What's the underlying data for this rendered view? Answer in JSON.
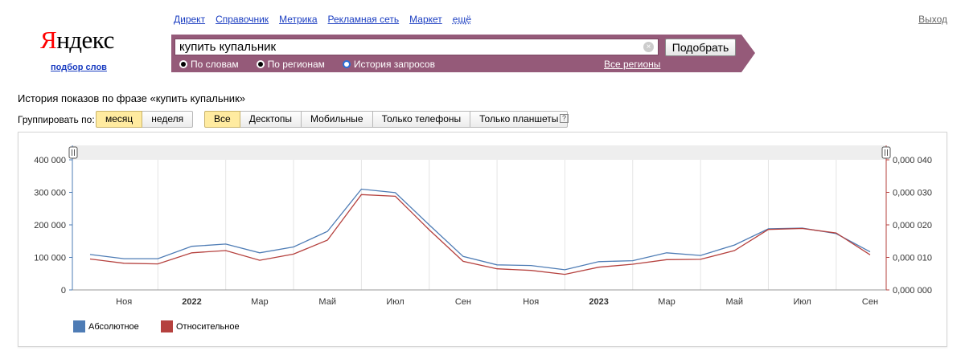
{
  "header": {
    "logo_first": "Я",
    "logo_rest": "ндекс",
    "logo_sub": "подбор слов",
    "services": [
      "Директ",
      "Справочник",
      "Метрика",
      "Рекламная сеть",
      "Маркет"
    ],
    "more": "ещё",
    "logout": "Выход"
  },
  "search": {
    "query": "купить купальник",
    "clear_icon": "×",
    "submit": "Подобрать",
    "modes": [
      {
        "label": "По словам",
        "selected": false
      },
      {
        "label": "По регионам",
        "selected": false
      },
      {
        "label": "История запросов",
        "selected": true
      }
    ],
    "regions": "Все регионы"
  },
  "page": {
    "title": "История показов по фразе «купить купальник»",
    "group_label": "Группировать по:",
    "group_options": [
      {
        "label": "месяц",
        "active": true
      },
      {
        "label": "неделя",
        "active": false
      }
    ],
    "device_options": [
      {
        "label": "Все",
        "active": true
      },
      {
        "label": "Десктопы",
        "active": false
      },
      {
        "label": "Мобильные",
        "active": false
      },
      {
        "label": "Только телефоны",
        "active": false
      },
      {
        "label": "Только планшеты",
        "active": false
      }
    ],
    "help_icon": "?"
  },
  "colors": {
    "absolute": "#4e7cb5",
    "relative": "#b5413e",
    "accent_panel": "#955a79"
  },
  "chart_data": {
    "type": "line",
    "x_labels": [
      "Ноя",
      "2022",
      "Мар",
      "Май",
      "Июл",
      "Сен",
      "Ноя",
      "2023",
      "Мар",
      "Май",
      "Июл",
      "Сен"
    ],
    "x_labels_bold": [
      "2022",
      "2023"
    ],
    "left_axis": {
      "ticks": [
        "0",
        "100 000",
        "200 000",
        "300 000",
        "400 000"
      ],
      "ylim": [
        0,
        400000
      ]
    },
    "right_axis": {
      "ticks": [
        "0,000 000",
        "0,000 010",
        "0,000 020",
        "0,000 030",
        "0,000 040"
      ],
      "ylim": [
        0,
        4e-05
      ]
    },
    "months": [
      "2021-10",
      "2021-11",
      "2021-12",
      "2022-01",
      "2022-02",
      "2022-03",
      "2022-04",
      "2022-05",
      "2022-06",
      "2022-07",
      "2022-08",
      "2022-09",
      "2022-10",
      "2022-11",
      "2022-12",
      "2023-01",
      "2023-02",
      "2023-03",
      "2023-04",
      "2023-05",
      "2023-06",
      "2023-07",
      "2023-08",
      "2023-09"
    ],
    "series": [
      {
        "name": "Абсолютное",
        "color": "#4e7cb5",
        "axis": "left",
        "values": [
          109000,
          96000,
          96000,
          134000,
          141000,
          114000,
          132000,
          180000,
          310000,
          299000,
          200000,
          103000,
          77000,
          75000,
          62000,
          87000,
          90000,
          114000,
          106000,
          138000,
          188000,
          190000,
          173000,
          117000
        ]
      },
      {
        "name": "Относительное",
        "color": "#b5413e",
        "axis": "right",
        "values": [
          9.5e-06,
          8.2e-06,
          8e-06,
          1.14e-05,
          1.21e-05,
          9.1e-06,
          1.1e-05,
          1.53e-05,
          2.93e-05,
          2.88e-05,
          1.85e-05,
          8.8e-06,
          6.5e-06,
          6e-06,
          4.8e-06,
          7e-06,
          7.9e-06,
          9.3e-06,
          9.4e-06,
          1.21e-05,
          1.86e-05,
          1.89e-05,
          1.75e-05,
          1.08e-05
        ]
      }
    ],
    "grid": true,
    "legend_position": "bottom-left"
  }
}
